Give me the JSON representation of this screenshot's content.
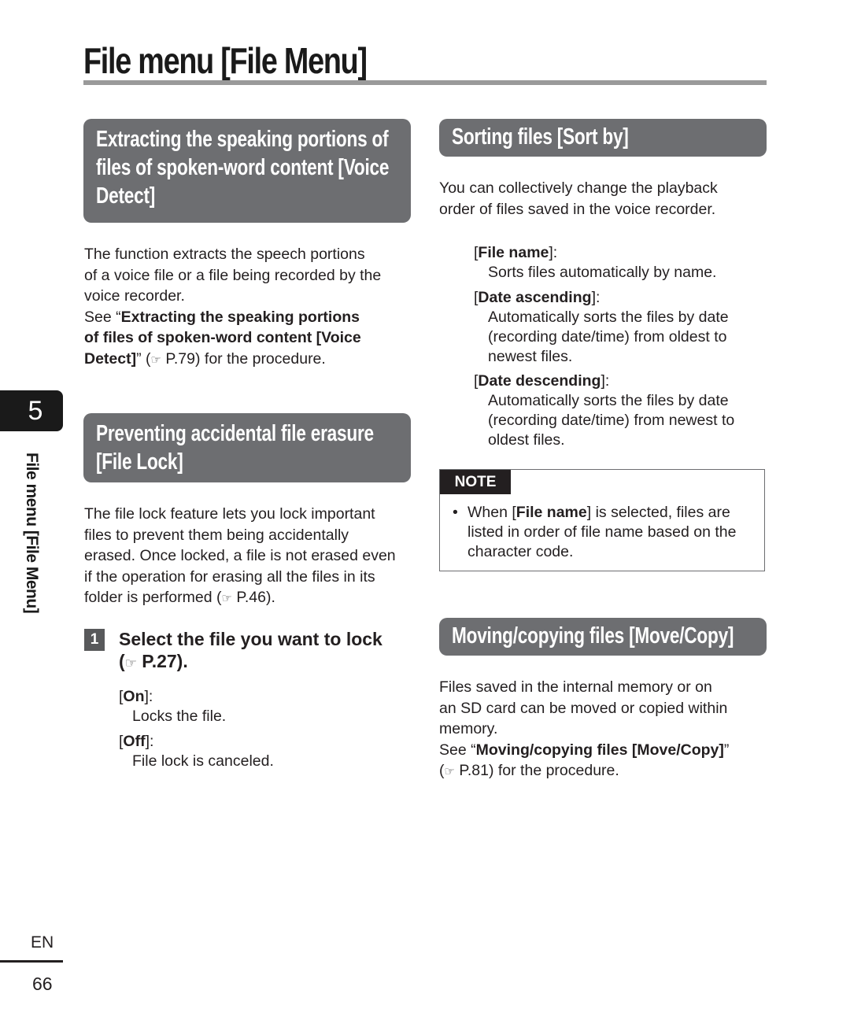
{
  "page": {
    "title": "File menu [File Menu]",
    "chapter_number": "5",
    "side_label": "File menu [File Menu]",
    "language": "EN",
    "page_number": "66"
  },
  "icons": {
    "reference": "pointing-hand-icon",
    "reference_glyph": "☞"
  },
  "voice_detect": {
    "heading_lines": [
      "Extracting the speaking portions of",
      "files of spoken-word content [Voice",
      "Detect]"
    ],
    "body_lines": [
      "The function extracts the speech portions",
      "of a voice file or a file being recorded by the",
      "voice recorder."
    ],
    "see_prefix": "See “",
    "see_bold_lines": [
      "Extracting the speaking portions",
      "of files of spoken-word content [Voice",
      "Detect]"
    ],
    "see_suffix_open": "” (",
    "see_page": " P.79) for the procedure."
  },
  "file_lock": {
    "heading_lines": [
      "Preventing accidental file erasure",
      "[File Lock]"
    ],
    "body_lines": [
      "The file lock feature lets you lock important",
      "files to prevent them being accidentally",
      "erased. Once locked, a file is not erased even",
      "if the operation for erasing all the files in its"
    ],
    "body_last_prefix": "folder is performed (",
    "body_last_page": " P.46).",
    "step_number": "1",
    "step_line1": "Select the file you want to lock",
    "step_line2_prefix": "(",
    "step_line2_page": " P.27).",
    "options": [
      {
        "label": "On",
        "desc": "Locks the file."
      },
      {
        "label": "Off",
        "desc": "File lock is canceled."
      }
    ]
  },
  "sort_by": {
    "heading": "Sorting files [Sort by]",
    "body_lines": [
      "You can collectively change the playback",
      "order of files saved in the voice recorder."
    ],
    "options": [
      {
        "label": "File name",
        "desc_lines": [
          "Sorts files automatically by name."
        ]
      },
      {
        "label": "Date ascending",
        "desc_lines": [
          "Automatically sorts the files by date",
          "(recording date/time) from oldest to",
          "newest files."
        ]
      },
      {
        "label": "Date descending",
        "desc_lines": [
          "Automatically sorts the files by date",
          "(recording date/time) from newest to",
          "oldest files."
        ]
      }
    ],
    "note": {
      "tag": "NOTE",
      "bullet": "•",
      "prefix": "When [",
      "bold": "File name",
      "suffix": "] is selected, files are",
      "lines": [
        "listed in order of file name based on the",
        "character code."
      ]
    }
  },
  "move_copy": {
    "heading": "Moving/copying files [Move/Copy]",
    "body_lines": [
      "Files saved in the internal memory or on",
      "an SD card can be moved or copied within",
      "memory."
    ],
    "see_prefix": "See “",
    "see_bold": "Moving/copying files [Move/Copy]",
    "see_suffix": "”",
    "ref_prefix": "(",
    "ref_page": " P.81) for the procedure."
  },
  "colors": {
    "heading_bg": "#6d6e71",
    "tab_bg": "#1a1a1a",
    "rule": "#9a9a9a"
  }
}
